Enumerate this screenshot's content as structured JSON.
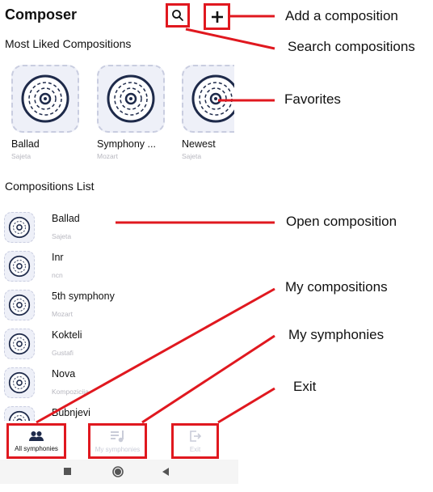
{
  "header": {
    "title": "Composer",
    "search_icon": "search-icon",
    "add_icon": "plus-icon"
  },
  "most_liked": {
    "title": "Most Liked Compositions",
    "items": [
      {
        "title": "Ballad",
        "author": "Sajeta"
      },
      {
        "title": "Symphony ...",
        "author": "Mozart"
      },
      {
        "title": "Newest",
        "author": "Sajeta"
      }
    ]
  },
  "compositions_list": {
    "title": "Compositions List",
    "items": [
      {
        "title": "Ballad",
        "author": "Sajeta"
      },
      {
        "title": "Inr",
        "author": "ncn"
      },
      {
        "title": "5th symphony",
        "author": "Mozart"
      },
      {
        "title": "Kokteli",
        "author": "Gustafi"
      },
      {
        "title": "Nova",
        "author": "Kompozicija"
      },
      {
        "title": "Bubnjevi",
        "author": ""
      }
    ]
  },
  "bottom_nav": {
    "items": [
      {
        "label": "All symphonies",
        "icon": "people-icon"
      },
      {
        "label": "My symphonies",
        "icon": "music-list-icon"
      },
      {
        "label": "Exit",
        "icon": "exit-icon"
      }
    ]
  },
  "system_nav": {
    "icons": [
      "square-icon",
      "circle-icon",
      "back-triangle-icon"
    ]
  },
  "annotations": {
    "add": "Add a composition",
    "search": "Search compositions",
    "favorites": "Favorites",
    "open": "Open composition",
    "my_compositions": "My compositions",
    "my_symphonies": "My symphonies",
    "exit": "Exit"
  },
  "colors": {
    "annotation_red": "#e0181f",
    "accent_navy": "#1e2a4a",
    "muted_text": "#b7b7bf",
    "card_bg": "#eef0f8"
  }
}
